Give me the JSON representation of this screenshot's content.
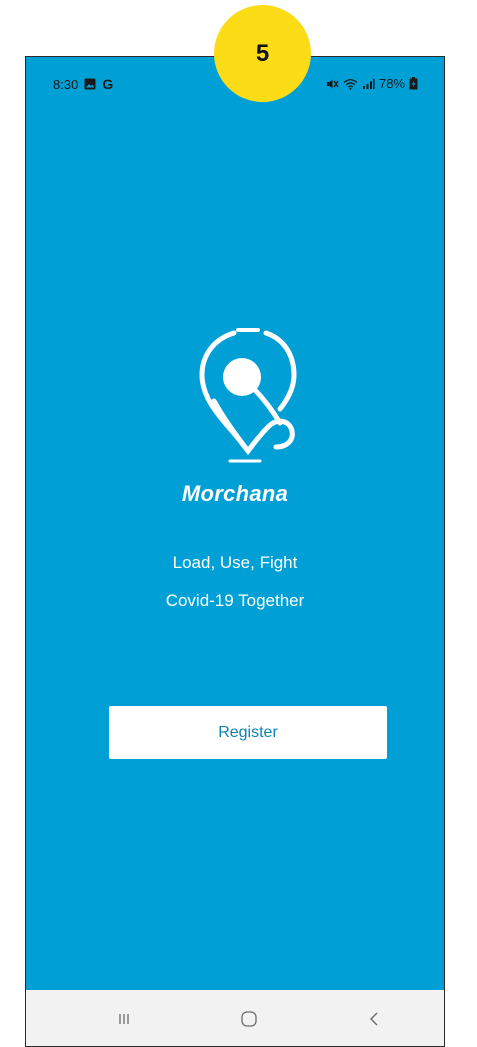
{
  "status_bar": {
    "time": "8:30",
    "left_icons": [
      "gallery-icon",
      "google-icon"
    ],
    "google_letter": "G",
    "right_icons": [
      "mute-icon",
      "wifi-icon",
      "signal-icon",
      "battery-icon"
    ],
    "battery_percent": "78%"
  },
  "badge": {
    "number": "5",
    "color": "#fcdc17"
  },
  "splash": {
    "logo_icon": "location-pin-stethoscope-icon",
    "app_name": "Morchana",
    "tagline_line1": "Load, Use, Fight",
    "tagline_line2": "Covid-19 Together",
    "background_color": "#00a0d6"
  },
  "register_button": {
    "label": "Register",
    "text_color": "#0c83b3"
  },
  "nav_bar": {
    "buttons": [
      "recent-apps-icon",
      "home-icon",
      "back-icon"
    ]
  }
}
